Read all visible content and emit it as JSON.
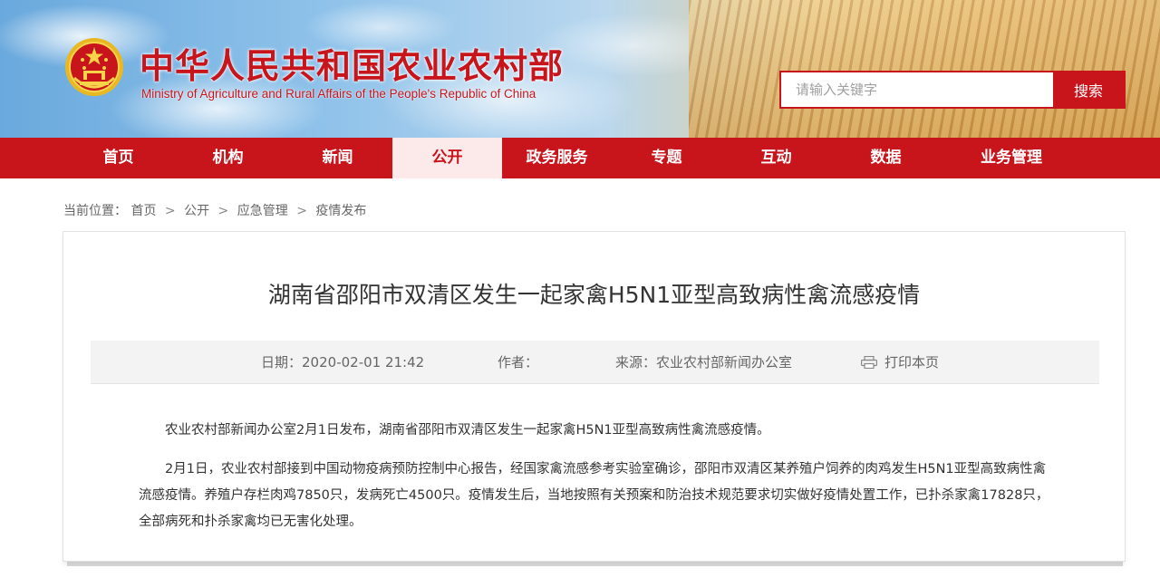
{
  "header": {
    "title": "中华人民共和国农业农村部",
    "subtitle": "Ministry of Agriculture and Rural Affairs of the People's Republic of China",
    "emblem_icon": "national-emblem-icon",
    "search": {
      "placeholder": "请输入关键字",
      "value": "",
      "button_label": "搜索"
    }
  },
  "nav": {
    "items": [
      {
        "label": "首页"
      },
      {
        "label": "机构"
      },
      {
        "label": "新闻"
      },
      {
        "label": "公开"
      },
      {
        "label": "政务服务"
      },
      {
        "label": "专题"
      },
      {
        "label": "互动"
      },
      {
        "label": "数据"
      },
      {
        "label": "业务管理"
      }
    ],
    "active": "公开"
  },
  "breadcrumb": {
    "prefix": "当前位置：",
    "items": [
      "首页",
      "公开",
      "应急管理",
      "疫情发布"
    ],
    "separator": ">"
  },
  "article": {
    "title": "湖南省邵阳市双清区发生一起家禽H5N1亚型高致病性禽流感疫情",
    "meta": {
      "date_label": "日期：",
      "date": "2020-02-01 21:42",
      "author_label": "作者：",
      "author": "",
      "source_label": "来源：",
      "source": "农业农村部新闻办公室",
      "print_label": "打印本页",
      "print_icon": "printer-icon"
    },
    "paragraphs": [
      "农业农村部新闻办公室2月1日发布，湖南省邵阳市双清区发生一起家禽H5N1亚型高致病性禽流感疫情。",
      "2月1日，农业农村部接到中国动物疫病预防控制中心报告，经国家禽流感参考实验室确诊，邵阳市双清区某养殖户饲养的肉鸡发生H5N1亚型高致病性禽流感疫情。养殖户存栏肉鸡7850只，发病死亡4500只。疫情发生后，当地按照有关预案和防治技术规范要求切实做好疫情处置工作，已扑杀家禽17828只，全部病死和扑杀家禽均已无害化处理。"
    ]
  },
  "colors": {
    "brand_red": "#c8141b",
    "active_tab_bg": "#fce9e9",
    "meta_bar_bg": "#f3f3f3"
  }
}
